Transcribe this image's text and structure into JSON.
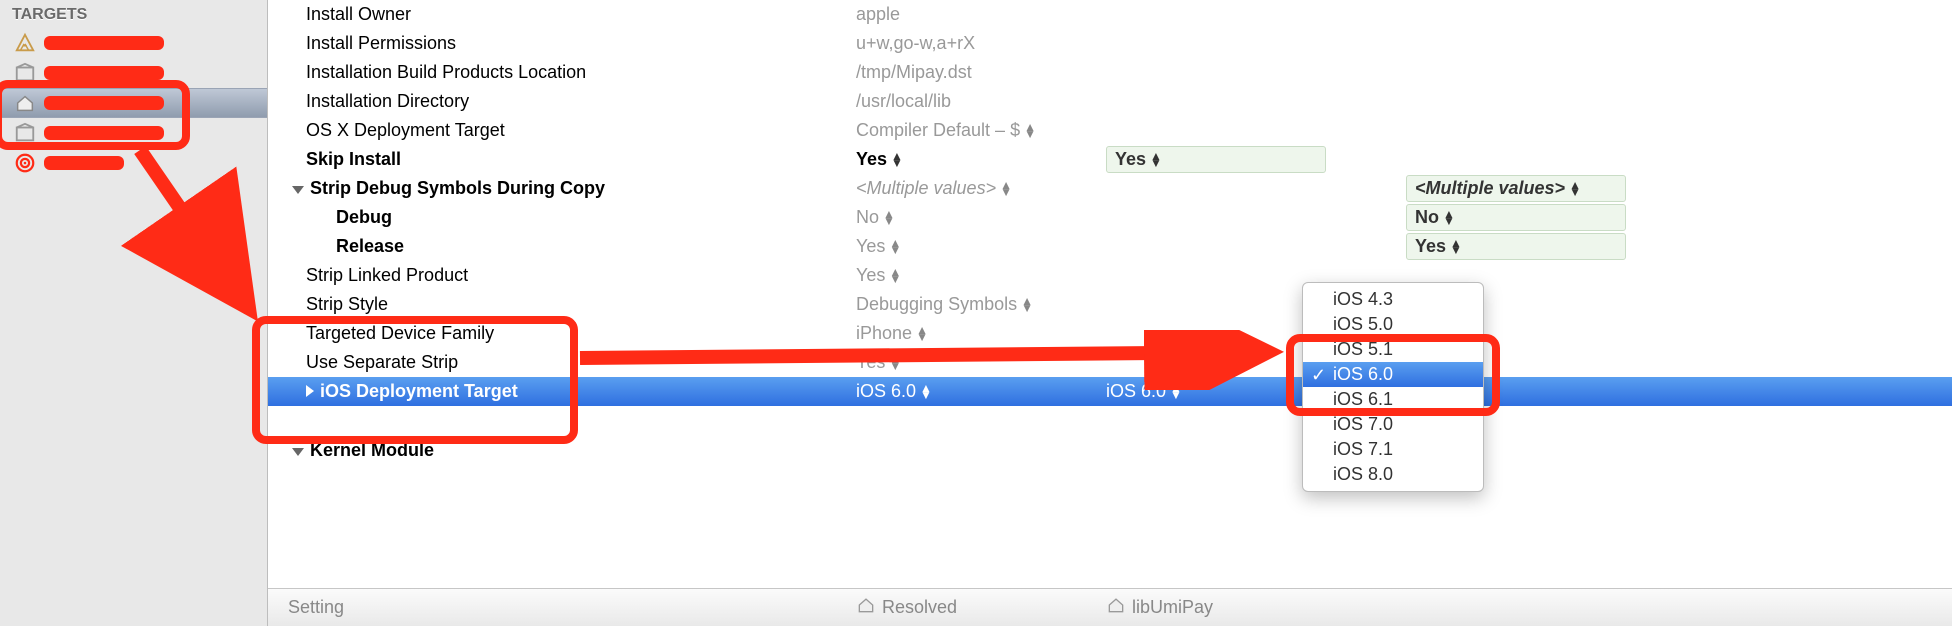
{
  "sidebar": {
    "header": "TARGETS"
  },
  "settings": {
    "rows": [
      {
        "label": "Install Owner",
        "value": "apple"
      },
      {
        "label": "Install Permissions",
        "value": "u+w,go-w,a+rX"
      },
      {
        "label": "Installation Build Products Location",
        "value": "/tmp/Mipay.dst"
      },
      {
        "label": "Installation Directory",
        "value": "/usr/local/lib"
      },
      {
        "label": "OS X Deployment Target",
        "value": "Compiler Default  –  $"
      },
      {
        "label": "Skip Install",
        "value": "Yes",
        "right": "Yes"
      },
      {
        "label": "Strip Debug Symbols During Copy",
        "value": "<Multiple values>",
        "right": "<Multiple values>"
      },
      {
        "label": "Debug",
        "value": "No",
        "right": "No"
      },
      {
        "label": "Release",
        "value": "Yes",
        "right": "Yes"
      },
      {
        "label": "Strip Linked Product",
        "value": "Yes"
      },
      {
        "label": "Strip Style",
        "value": "Debugging Symbols"
      },
      {
        "label": "Targeted Device Family",
        "value": "iPhone"
      },
      {
        "label": "Use Separate Strip",
        "value": "Yes"
      },
      {
        "label": "iOS Deployment Target",
        "value": "iOS 6.0",
        "right": "iOS 6.0"
      }
    ],
    "kernel_header": "Kernel Module"
  },
  "footer": {
    "setting": "Setting",
    "resolved": "Resolved",
    "target": "libUmiPay"
  },
  "popup": {
    "items": [
      "iOS 4.3",
      "iOS 5.0",
      "iOS 5.1",
      "iOS 6.0",
      "iOS 6.1",
      "iOS 7.0",
      "iOS 7.1",
      "iOS 8.0"
    ],
    "selected": "iOS 6.0"
  }
}
